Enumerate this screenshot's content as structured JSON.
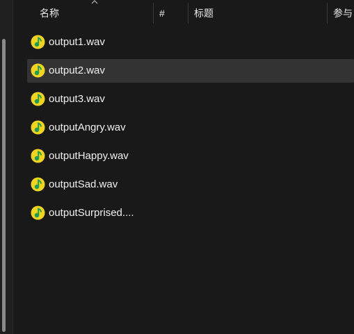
{
  "columns": [
    {
      "label": "名称"
    },
    {
      "label": "#"
    },
    {
      "label": "标题"
    },
    {
      "label": "参与"
    }
  ],
  "files": [
    {
      "name": "output1.wav",
      "icon": "music-file-icon",
      "selected": false
    },
    {
      "name": "output2.wav",
      "icon": "music-file-icon",
      "selected": true
    },
    {
      "name": "output3.wav",
      "icon": "music-file-icon",
      "selected": false
    },
    {
      "name": "outputAngry.wav",
      "icon": "music-file-icon",
      "selected": false
    },
    {
      "name": "outputHappy.wav",
      "icon": "music-file-icon",
      "selected": false
    },
    {
      "name": "outputSad.wav",
      "icon": "music-file-icon",
      "selected": false
    },
    {
      "name": "outputSurprised....",
      "icon": "music-file-icon",
      "selected": false
    }
  ],
  "colors": {
    "background": "#191919",
    "selected_row": "#333333",
    "icon_yellow": "#f2d41c",
    "icon_green": "#1a9c5a"
  }
}
